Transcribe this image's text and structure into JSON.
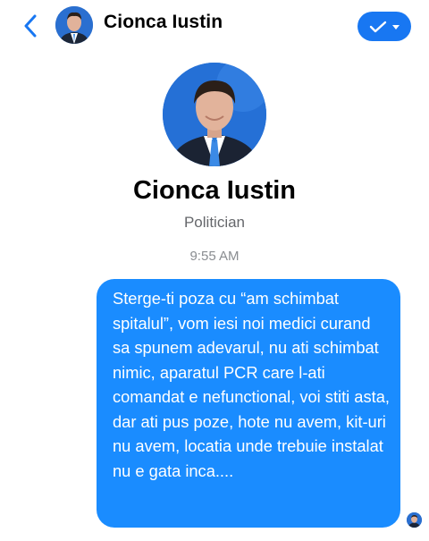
{
  "header": {
    "contact_name": "Cionca Iustin",
    "back_icon": "chevron-left-icon",
    "action_icon": "checkmark-icon",
    "accent": "#1877f2"
  },
  "profile": {
    "name": "Cionca Iustin",
    "role": "Politician"
  },
  "conversation": {
    "timestamp": "9:55 AM",
    "messages": [
      {
        "direction": "outgoing",
        "text": "Sterge-ti poza cu “am schimbat spitalul”, vom iesi noi medici curand sa spunem adevarul, nu ati schimbat nimic, aparatul PCR care l-ati comandat e nefunctional, voi stiti asta, dar ati pus poze, hote nu avem, kit-uri nu avem, locatia unde trebuie instalat nu e gata inca....",
        "bubble_color": "#1a8cff"
      }
    ]
  }
}
